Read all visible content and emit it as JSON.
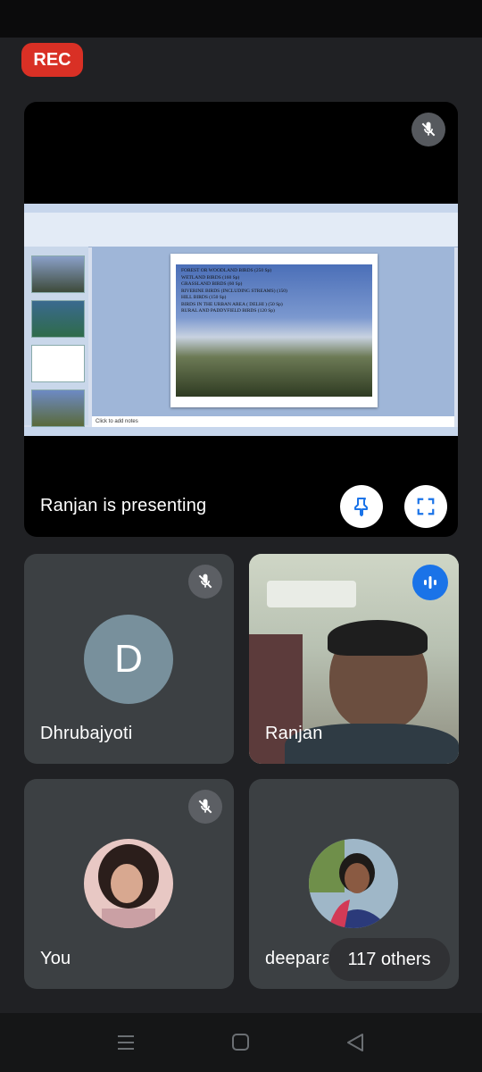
{
  "recording": {
    "label": "REC"
  },
  "presentation": {
    "presenter_label": "Ranjan is presenting",
    "slide": {
      "lines": [
        "FOREST OR WOODLAND BIRDS (250 Sp)",
        "WETLAND BIRDS (160 Sp)",
        "GRASSLAND BIRDS (60 Sp)",
        "RIVERINE BIRDS (INCLUDING STREAMS) (150)",
        "HILL BIRDS (150 Sp)",
        "BIRDS IN THE URBAN AREA ( DELHI ) (50 Sp)",
        "RURAL AND PADDYFIELD BIRDS (120 Sp)"
      ],
      "notes_placeholder": "Click to add notes"
    },
    "icons": {
      "pin": "pin-icon",
      "fullscreen": "fullscreen-icon",
      "mute": "mic-off-icon"
    }
  },
  "participants": [
    {
      "name": "Dhrubajyoti",
      "initial": "D",
      "muted": true
    },
    {
      "name": "Ranjan",
      "speaking": true
    },
    {
      "name": "You",
      "muted": true
    },
    {
      "name": "deepara"
    }
  ],
  "others_badge": "117 others",
  "colors": {
    "rec": "#d93025",
    "speaking": "#1a73e8",
    "background": "#202124",
    "tile": "#3c4043"
  }
}
